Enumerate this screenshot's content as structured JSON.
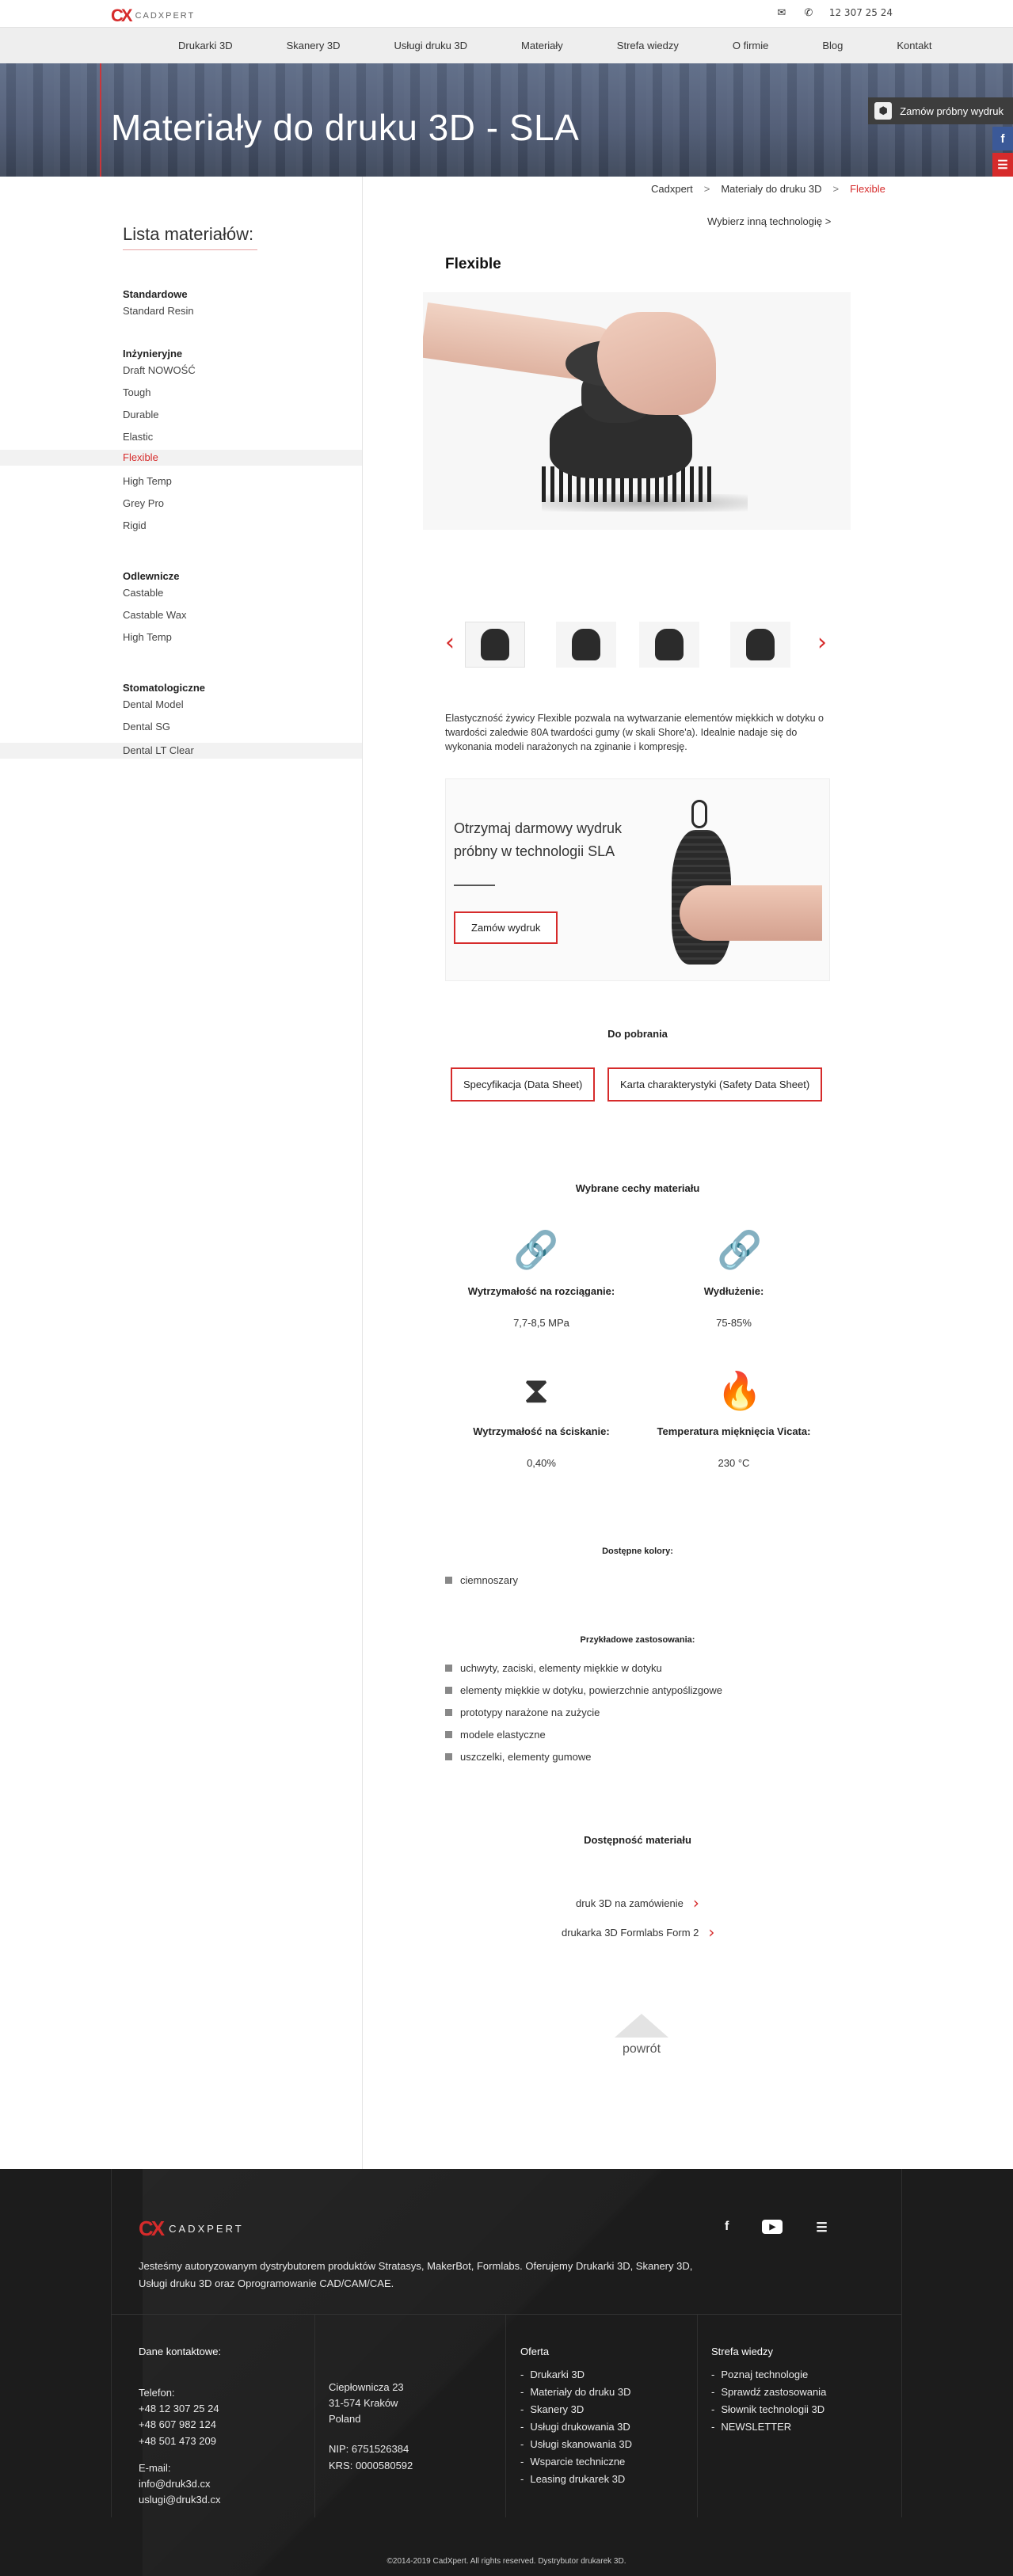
{
  "header": {
    "logo_text": "CADXPERT",
    "phone": "12 307 25 24",
    "icons": [
      "mail-icon",
      "phone-icon"
    ]
  },
  "nav": {
    "items": [
      {
        "label": "Drukarki 3D"
      },
      {
        "label": "Skanery 3D"
      },
      {
        "label": "Usługi druku 3D"
      },
      {
        "label": "Materiały"
      },
      {
        "label": "Strefa wiedzy"
      },
      {
        "label": "O firmie"
      },
      {
        "label": "Blog"
      },
      {
        "label": "Kontakt"
      }
    ]
  },
  "hero": {
    "title": "Materiały do druku 3D - SLA",
    "order_button": "Zamów próbny wydruk"
  },
  "breadcrumb": {
    "items": [
      "Cadxpert",
      "Materiały do druku 3D",
      "Flexible"
    ],
    "separator": ">"
  },
  "other_tech_link": "Wybierz inną technologię >",
  "sidebar": {
    "title": "Lista materiałów:",
    "groups": [
      {
        "title": "Standardowe",
        "items": [
          "Standard Resin"
        ]
      },
      {
        "title": "Inżynieryjne",
        "items": [
          "Draft NOWOŚĆ",
          "Tough",
          "Durable",
          "Elastic",
          "Flexible",
          "High Temp",
          "Grey Pro",
          "Rigid"
        ]
      },
      {
        "title": "Odlewnicze",
        "items": [
          "Castable",
          "Castable Wax",
          "High Temp"
        ]
      },
      {
        "title": "Stomatologiczne",
        "items": [
          "Dental Model",
          "Dental SG",
          "Dental LT Clear"
        ]
      }
    ],
    "active_item": "Flexible"
  },
  "material": {
    "title": "Flexible",
    "description": "Elastyczność żywicy Flexible pozwala na wytwarzanie elementów miękkich w dotyku o twardości zaledwie 80A twardości gumy (w skali Shore'a). Idealnie nadaje się do wykonania modeli narażonych na zginanie i kompresję."
  },
  "promo": {
    "text": "Otrzymaj darmowy wydruk próbny w technologii SLA",
    "button": "Zamów wydruk"
  },
  "downloads": {
    "title": "Do pobrania",
    "buttons": [
      "Specyfikacja (Data Sheet)",
      "Karta charakterystyki (Safety Data Sheet)"
    ]
  },
  "features": {
    "title": "Wybrane cechy materiału",
    "items": [
      {
        "label": "Wytrzymałość na rozciąganie:",
        "value": "7,7-8,5 MPa",
        "icon": "link-icon"
      },
      {
        "label": "Wydłużenie:",
        "value": "75-85%",
        "icon": "link-icon"
      },
      {
        "label": "Wytrzymałość na ściskanie:",
        "value": "0,40%",
        "icon": "hourglass-icon"
      },
      {
        "label": "Temperatura mięknięcia Vicata:",
        "value": "230 °C",
        "icon": "flame-icon"
      }
    ]
  },
  "colors": {
    "title": "Dostępne kolory:",
    "items": [
      "ciemnoszary"
    ]
  },
  "applications": {
    "title": "Przykładowe zastosowania:",
    "items": [
      "uchwyty, zaciski, elementy miękkie w dotyku",
      "elementy miękkie w dotyku, powierzchnie antypoślizgowe",
      "prototypy narażone na zużycie",
      "modele elastyczne",
      "uszczelki, elementy gumowe"
    ]
  },
  "availability": {
    "title": "Dostępność materiału",
    "links": [
      "druk 3D na zamówienie",
      "drukarka 3D Formlabs Form 2"
    ]
  },
  "back_to_top": "powrót",
  "footer": {
    "logo_text": "CADXPERT",
    "about": "Jesteśmy autoryzowanym dystrybutorem produktów Stratasys, MakerBot, Formlabs. Oferujemy Drukarki 3D, Skanery 3D, Usługi druku 3D oraz Oprogramowanie CAD/CAM/CAE.",
    "contact": {
      "title": "Dane kontaktowe:",
      "phone_label": "Telefon:",
      "phones": [
        "+48 12 307 25 24",
        "+48 607 982 124",
        "+48 501 473 209"
      ],
      "email_label": "E-mail:",
      "emails": [
        "info@druk3d.cx",
        "uslugi@druk3d.cx"
      ]
    },
    "address": {
      "street": "Ciepłownicza 23",
      "city": "31-574 Kraków",
      "country": "Poland",
      "nip": "NIP: 6751526384",
      "krs": "KRS: 0000580592"
    },
    "offer": {
      "title": "Oferta",
      "items": [
        "Drukarki 3D",
        "Materiały do druku 3D",
        "Skanery 3D",
        "Usługi drukowania 3D",
        "Usługi skanowania 3D",
        "Wsparcie techniczne",
        "Leasing drukarek 3D"
      ]
    },
    "knowledge": {
      "title": "Strefa wiedzy",
      "items": [
        "Poznaj technologie",
        "Sprawdź zastosowania",
        "Słownik technologii 3D",
        "NEWSLETTER"
      ]
    },
    "copyright": "©2014-2019 CadXpert. All rights reserved. Dystrybutor drukarek 3D."
  },
  "colors_ui": {
    "accent": "#d62b2b",
    "nav_bg": "#eeeeee",
    "footer_bg": "#1c1c1c"
  }
}
